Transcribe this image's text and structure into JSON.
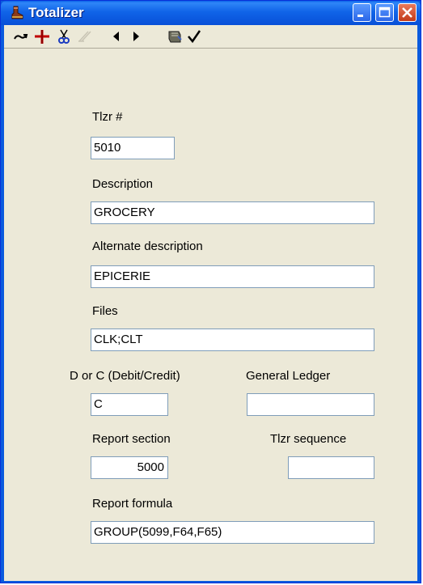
{
  "window": {
    "title": "Totalizer",
    "controls": {
      "minimize": "minimize-icon",
      "maximize": "maximize-icon",
      "close": "close-icon"
    }
  },
  "toolbar": {
    "icons": [
      "redo-icon",
      "add-icon",
      "cut-icon",
      "clear-icon",
      "previous-icon",
      "next-icon",
      "save-icon",
      "accept-icon"
    ]
  },
  "form": {
    "tlzr_label": "Tlzr #",
    "tlzr_value": "5010",
    "description_label": "Description",
    "description_value": "GROCERY",
    "alt_description_label": "Alternate description",
    "alt_description_value": "EPICERIE",
    "files_label": "Files",
    "files_value": "CLK;CLT",
    "debit_credit_label": "D or C (Debit/Credit)",
    "debit_credit_value": "C",
    "general_ledger_label": "General Ledger",
    "general_ledger_value": "",
    "report_section_label": "Report section",
    "report_section_value": "5000",
    "tlzr_sequence_label": "Tlzr sequence",
    "tlzr_sequence_value": "",
    "report_formula_label": "Report formula",
    "report_formula_value": "GROUP(5099,F64,F65)"
  },
  "colors": {
    "titlebar": "#0A5ADE",
    "client": "#ECE9D8",
    "field_border": "#7F9DB9",
    "close": "#C23A18"
  }
}
